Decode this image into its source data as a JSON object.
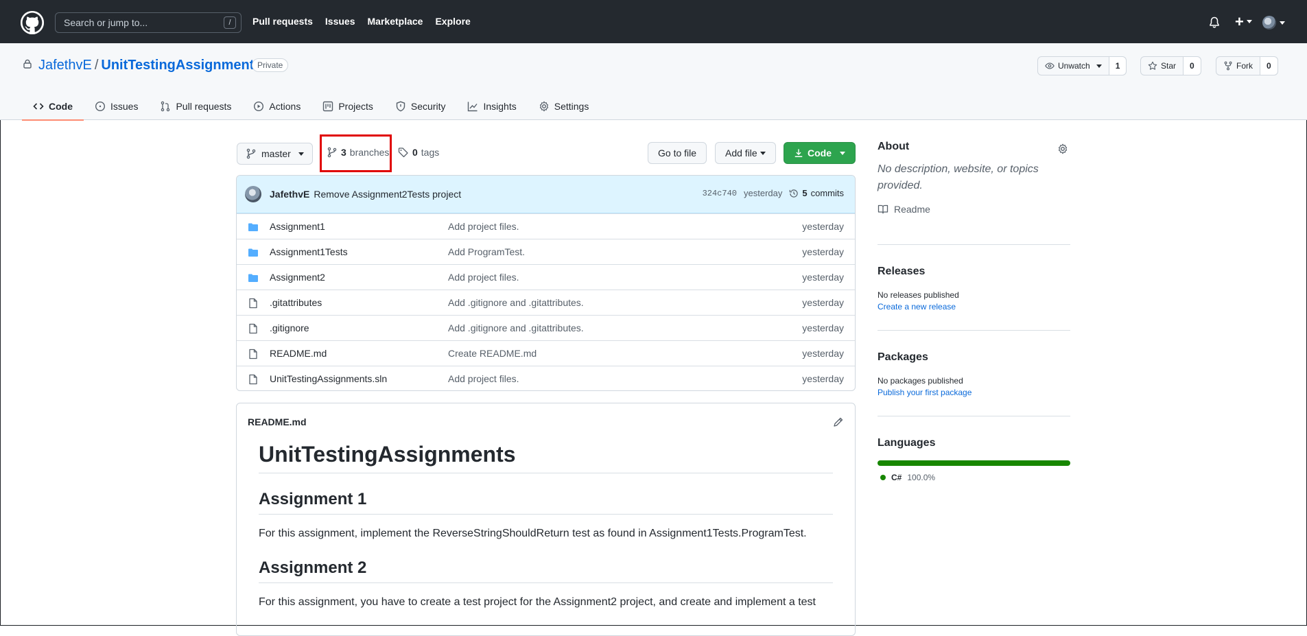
{
  "topbar": {
    "search_placeholder": "Search or jump to...",
    "search_shortcut": "/",
    "nav": [
      "Pull requests",
      "Issues",
      "Marketplace",
      "Explore"
    ],
    "plus_label": "+"
  },
  "repo": {
    "owner": "JafethvE",
    "separator": "/",
    "name": "UnitTestingAssignments",
    "visibility": "Private",
    "watch_label": "Unwatch",
    "watch_count": "1",
    "star_label": "Star",
    "star_count": "0",
    "fork_label": "Fork",
    "fork_count": "0"
  },
  "tabs": [
    {
      "label": "Code",
      "icon": "code-icon",
      "active": true
    },
    {
      "label": "Issues",
      "icon": "issue-icon"
    },
    {
      "label": "Pull requests",
      "icon": "pull-request-icon"
    },
    {
      "label": "Actions",
      "icon": "play-icon"
    },
    {
      "label": "Projects",
      "icon": "project-icon"
    },
    {
      "label": "Security",
      "icon": "shield-icon"
    },
    {
      "label": "Insights",
      "icon": "graph-icon"
    },
    {
      "label": "Settings",
      "icon": "gear-icon"
    }
  ],
  "toolbar": {
    "branch": "master",
    "branches_count": "3",
    "branches_label": "branches",
    "tags_count": "0",
    "tags_label": "tags",
    "go_to_file": "Go to file",
    "add_file": "Add file",
    "code": "Code"
  },
  "commit": {
    "author": "JafethvE",
    "message": "Remove Assignment2Tests project",
    "sha": "324c740",
    "age": "yesterday",
    "count": "5",
    "count_label": "commits"
  },
  "files": [
    {
      "type": "folder",
      "name": "Assignment1",
      "message": "Add project files.",
      "age": "yesterday"
    },
    {
      "type": "folder",
      "name": "Assignment1Tests",
      "message": "Add ProgramTest.",
      "age": "yesterday"
    },
    {
      "type": "folder",
      "name": "Assignment2",
      "message": "Add project files.",
      "age": "yesterday"
    },
    {
      "type": "file",
      "name": ".gitattributes",
      "message": "Add .gitignore and .gitattributes.",
      "age": "yesterday"
    },
    {
      "type": "file",
      "name": ".gitignore",
      "message": "Add .gitignore and .gitattributes.",
      "age": "yesterday"
    },
    {
      "type": "file",
      "name": "README.md",
      "message": "Create README.md",
      "age": "yesterday"
    },
    {
      "type": "file",
      "name": "UnitTestingAssignments.sln",
      "message": "Add project files.",
      "age": "yesterday"
    }
  ],
  "readme": {
    "filename": "README.md",
    "h1": "UnitTestingAssignments",
    "sections": [
      {
        "heading": "Assignment 1",
        "text": "For this assignment, implement the ReverseStringShouldReturn test as found in Assignment1Tests.ProgramTest."
      },
      {
        "heading": "Assignment 2",
        "text": "For this assignment, you have to create a test project for the Assignment2 project, and create and implement a test"
      }
    ]
  },
  "sidebar": {
    "about_title": "About",
    "about_desc": "No description, website, or topics provided.",
    "readme_label": "Readme",
    "releases_title": "Releases",
    "releases_none": "No releases published",
    "releases_link": "Create a new release",
    "packages_title": "Packages",
    "packages_none": "No packages published",
    "packages_link": "Publish your first package",
    "languages_title": "Languages",
    "language_name": "C#",
    "language_pct": "100.0%",
    "language_color": "#178600"
  },
  "colors": {
    "header_bg": "#24292f",
    "link": "#0969da",
    "green_button": "#2da44e",
    "active_tab_underline": "#fd8c73",
    "highlight_box": "#e00000"
  }
}
